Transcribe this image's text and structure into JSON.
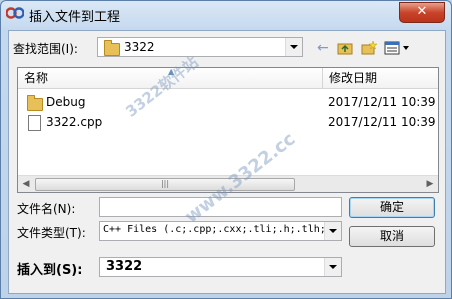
{
  "window": {
    "title": "插入文件到工程",
    "close_label": "✕"
  },
  "look_in": {
    "label": "查找范围(I):",
    "value": "3322"
  },
  "toolbar": {
    "back_icon": "back-arrow-icon",
    "up_icon": "up-folder-icon",
    "new_folder_icon": "new-folder-icon",
    "view_icon": "view-menu-icon"
  },
  "list": {
    "columns": [
      {
        "label": "名称"
      },
      {
        "label": "修改日期"
      }
    ],
    "items": [
      {
        "name": "Debug",
        "type": "folder",
        "modified": "2017/12/11 10:39"
      },
      {
        "name": "3322.cpp",
        "type": "file",
        "modified": "2017/12/11 10:39"
      }
    ]
  },
  "filename": {
    "label": "文件名(N):",
    "value": ""
  },
  "filetype": {
    "label": "文件类型(T):",
    "value": "C++ Files (.c;.cpp;.cxx;.tli;.h;.tlh;"
  },
  "insert_into": {
    "label": "插入到(S):",
    "value": "3322"
  },
  "buttons": {
    "ok": "确定",
    "cancel": "取消"
  },
  "watermark": {
    "text1": "3322软件站",
    "text2": "www.3322.cc"
  }
}
